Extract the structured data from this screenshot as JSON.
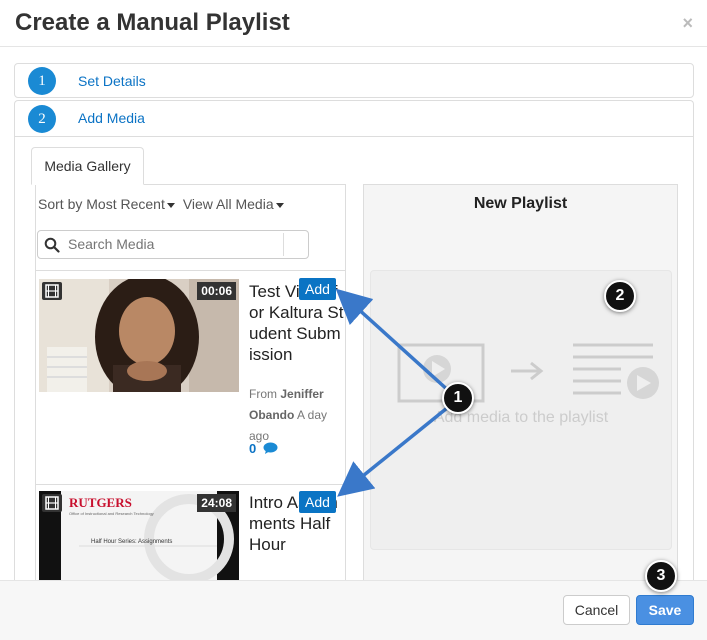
{
  "modal": {
    "title": "Create a Manual Playlist",
    "close_label": "×"
  },
  "steps": [
    {
      "number": "1",
      "label": "Set Details"
    },
    {
      "number": "2",
      "label": "Add Media"
    }
  ],
  "gallery": {
    "tab_label": "Media Gallery",
    "sort_label": "Sort by Most Recent",
    "filter_label": "View All Media",
    "search_placeholder": "Search Media",
    "items": [
      {
        "duration": "00:06",
        "title": "Test Video for Kaltura Student Submission",
        "add_label": "Add",
        "from_label": "From",
        "author": "Jeniffer Obando",
        "time": "A day ago",
        "likes": "0"
      },
      {
        "duration": "24:08",
        "title": "Intro Assignments Half Hour",
        "add_label": "Add",
        "thumb_brand": "RUTGERS",
        "thumb_sub": "Office of Instructional and Research Technology",
        "thumb_caption": "Half Hour Series: Assignments"
      }
    ]
  },
  "playlist": {
    "title": "New Playlist",
    "placeholder": "Add media to the playlist"
  },
  "footer": {
    "cancel_label": "Cancel",
    "save_label": "Save"
  },
  "callouts": [
    "1",
    "2",
    "3"
  ],
  "colors": {
    "accent": "#1a8ad4",
    "add_button": "#0a74c4",
    "save_button": "#4a90e2",
    "arrow": "#3a78c9"
  }
}
